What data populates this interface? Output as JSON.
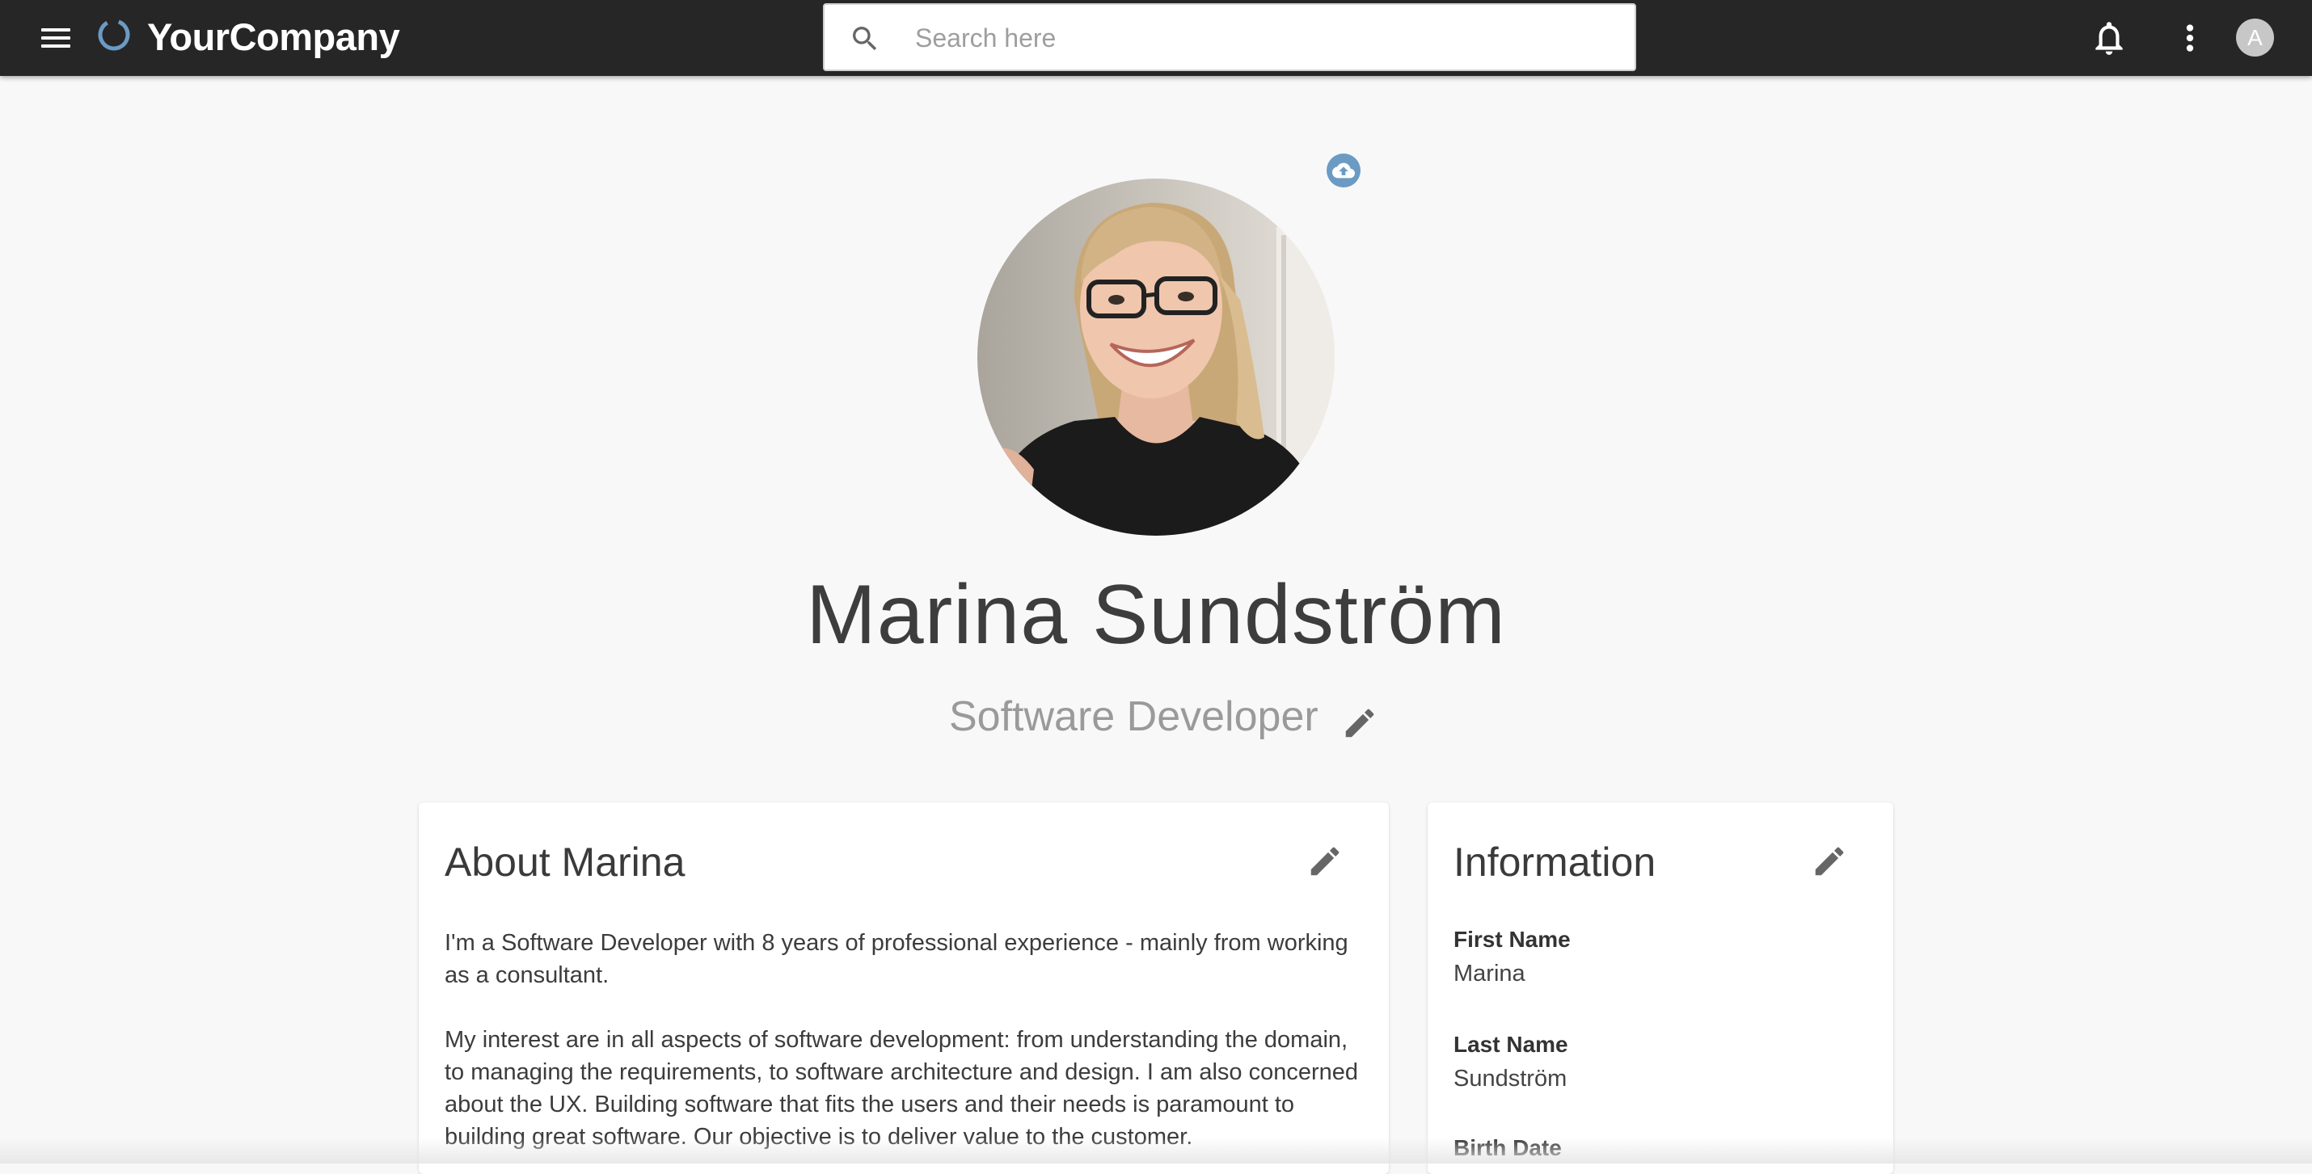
{
  "header": {
    "brand": "YourCompany",
    "search_placeholder": "Search here",
    "avatar_initial": "A",
    "accent_color": "#6b9bc3",
    "icons": [
      "menu-icon",
      "logo-icon",
      "search-icon",
      "bell-icon",
      "more-vert-icon"
    ]
  },
  "profile": {
    "name": "Marina Sundström",
    "job_title": "Software Developer",
    "photo_icon": "cloud-upload-icon"
  },
  "about": {
    "title": "About Marina",
    "paragraphs": [
      "I'm a Software Developer with 8 years of professional experience - mainly from working as a consultant.",
      "My interest are in all aspects of software development: from understanding the domain, to managing the requirements, to software architecture and design. I am also concerned about the UX. Building software that fits the users and their needs is paramount to building great software. Our objective is to deliver value to the customer."
    ]
  },
  "information": {
    "title": "Information",
    "fields": [
      {
        "label": "First Name",
        "value": "Marina"
      },
      {
        "label": "Last Name",
        "value": "Sundström"
      },
      {
        "label": "Birth Date",
        "value": ""
      }
    ]
  }
}
